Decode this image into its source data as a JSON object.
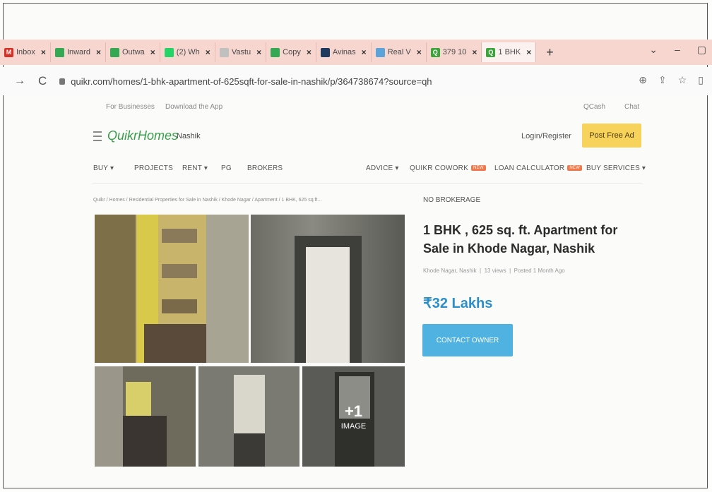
{
  "browser": {
    "tabs": [
      {
        "label": "Inbox",
        "fav": "M",
        "color": "#d93025"
      },
      {
        "label": "Inward",
        "fav": "",
        "color": "#34a853"
      },
      {
        "label": "Outwa",
        "fav": "",
        "color": "#34a853"
      },
      {
        "label": "(2) Wh",
        "fav": "",
        "color": "#25d366"
      },
      {
        "label": "Vastu",
        "fav": "",
        "color": "#c0c0c0"
      },
      {
        "label": "Copy",
        "fav": "",
        "color": "#34a853"
      },
      {
        "label": "Avinas",
        "fav": "",
        "color": "#1e3a5f"
      },
      {
        "label": "Real V",
        "fav": "",
        "color": "#5ba3d9"
      },
      {
        "label": "379 10",
        "fav": "Q",
        "color": "#3aa53a"
      },
      {
        "label": "1 BHK",
        "fav": "Q",
        "color": "#3aa53a"
      }
    ],
    "new_tab": "+",
    "url": "quikr.com/homes/1-bhk-apartment-of-625sqft-for-sale-in-nashik/p/364738674?source=qh"
  },
  "util": {
    "businesses": "For Businesses",
    "download": "Download the App",
    "qcash": "QCash",
    "chat": "Chat"
  },
  "header": {
    "logo_main": "Quikr",
    "logo_sub": "Homes",
    "city": "Nashik",
    "login": "Login/Register",
    "post": "Post Free Ad"
  },
  "nav": {
    "left": [
      "BUY",
      "PROJECTS",
      "RENT",
      "PG",
      "BROKERS"
    ],
    "right": [
      "ADVICE",
      "QUIKR COWORK",
      "LOAN CALCULATOR",
      "BUY SERVICES"
    ],
    "badge": "NEW"
  },
  "breadcrumb": "Quikr / Homes / Residential Properties for Sale in Nashik / Khode Nagar / Apartment / 1 BHK, 625 sq.ft...",
  "listing": {
    "tag": "NO BROKERAGE",
    "title": "1 BHK , 625 sq. ft. Apartment for Sale in Khode Nagar, Nashik",
    "location": "Khode Nagar, Nashik",
    "views": "13 views",
    "posted": "Posted 1 Month Ago",
    "price": "₹32 Lakhs",
    "contact": "CONTACT OWNER",
    "more_count": "+1",
    "more_label": "IMAGE"
  }
}
